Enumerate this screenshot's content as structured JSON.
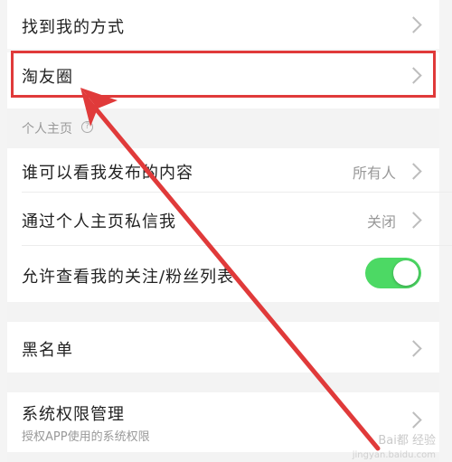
{
  "settings": {
    "rows": {
      "find_me": {
        "label": "找到我的方式"
      },
      "taoyouquan": {
        "label": "淘友圈"
      },
      "who_can_view": {
        "label": "谁可以看我发布的内容",
        "value": "所有人"
      },
      "private_message": {
        "label": "通过个人主页私信我",
        "value": "关闭"
      },
      "follow_list": {
        "label": "允许查看我的关注/粉丝列表",
        "toggle_on": true
      },
      "blacklist": {
        "label": "黑名单"
      },
      "system_permissions": {
        "label": "系统权限管理",
        "sublabel": "授权APP使用的系统权限"
      }
    },
    "section_header": {
      "label": "个人主页"
    }
  },
  "annotation": {
    "color": "#e03a3a"
  },
  "watermark": {
    "text": "Bai都 经验",
    "sub": "jingyan.baidu.com"
  },
  "colors": {
    "toggle_on": "#4cd964",
    "highlight": "#e03a3a"
  }
}
